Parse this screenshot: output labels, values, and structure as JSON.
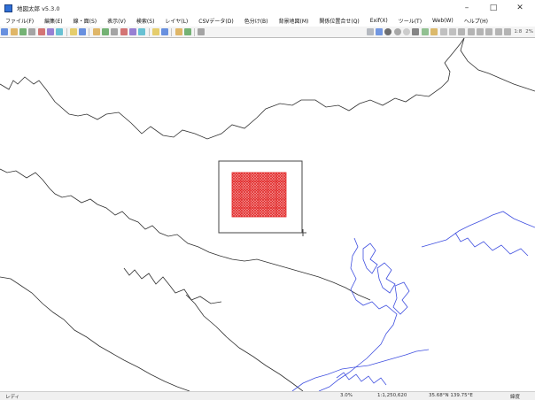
{
  "window": {
    "title": "地図太郎 v5.3.0",
    "controls": {
      "minimize": "–",
      "maximize": "□",
      "close": "✕"
    }
  },
  "menubar": {
    "items": [
      "ファイル(F)",
      "編集(E)",
      "線・面(S)",
      "表示(V)",
      "検索(S)",
      "レイヤ(L)",
      "CSVデータ(D)",
      "色分け(B)",
      "背景地図(M)",
      "関係位置合せ(Q)",
      "Exif(X)",
      "ツール(T)",
      "Web(W)",
      "ヘルプ(H)"
    ]
  },
  "toolbar": {
    "icons": [
      "new-file-icon",
      "open-folder-icon",
      "save-icon",
      "copy-icon",
      "print-preview-icon",
      "print-icon",
      "grid-icon",
      "sep",
      "undo-icon",
      "redo-icon",
      "sep",
      "pan-icon",
      "select-icon",
      "zoom-in-icon",
      "zoom-out-icon",
      "fit-icon",
      "layer-icon",
      "sep",
      "binoculars-icon",
      "hand-icon",
      "sep",
      "table-icon",
      "chart-icon",
      "sep",
      "alert-icon"
    ],
    "right_icons": [
      "dropdown-icon",
      "color-icon",
      "circle-dark-icon",
      "circle-gray-icon",
      "circle-outline-icon",
      "pen-icon",
      "line-icon",
      "sphere-icon",
      "undo-small-icon",
      "redo-small-icon",
      "text-icon",
      "export-icon",
      "camera-icon",
      "scale-icon",
      "zoom-percent-icon",
      "frame-icon"
    ],
    "zoom_labels": [
      "1:8",
      "2%"
    ]
  },
  "status": {
    "left": "レディ",
    "mid": "3.0%",
    "scale": "1:1,250,620",
    "coords": "35.68°N 139.75°E",
    "right": "緯度"
  },
  "colors": {
    "map_lines": "#303030",
    "water_lines": "#4050e0",
    "selection_fill": "#e02020",
    "selection_frame": "#444444"
  }
}
